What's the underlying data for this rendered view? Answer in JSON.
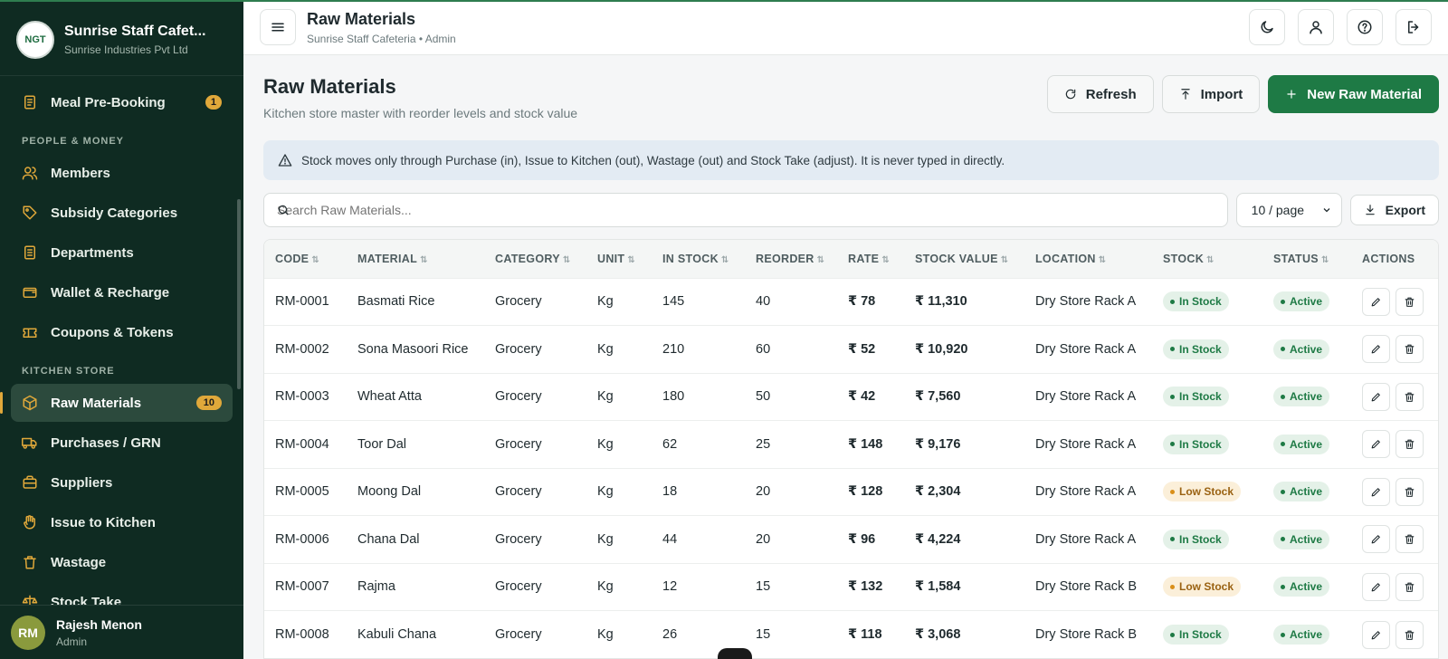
{
  "brand": {
    "name": "Sunrise Staff Cafet...",
    "sub": "Sunrise Industries Pvt Ltd",
    "logo_text": "NGT"
  },
  "sidebar": {
    "top_item": {
      "label": "Meal Pre-Booking",
      "badge": "1"
    },
    "section1": "PEOPLE & MONEY",
    "people": [
      {
        "label": "Members"
      },
      {
        "label": "Subsidy Categories"
      },
      {
        "label": "Departments"
      },
      {
        "label": "Wallet & Recharge"
      },
      {
        "label": "Coupons & Tokens"
      }
    ],
    "section2": "KITCHEN STORE",
    "kitchen": [
      {
        "label": "Raw Materials",
        "badge": "10"
      },
      {
        "label": "Purchases / GRN"
      },
      {
        "label": "Suppliers"
      },
      {
        "label": "Issue to Kitchen"
      },
      {
        "label": "Wastage"
      },
      {
        "label": "Stock Take"
      }
    ]
  },
  "user": {
    "initials": "RM",
    "name": "Rajesh Menon",
    "role": "Admin"
  },
  "topbar": {
    "title": "Raw Materials",
    "subtitle": "Sunrise Staff Cafeteria • Admin"
  },
  "page": {
    "title": "Raw Materials",
    "subtitle": "Kitchen store master with reorder levels and stock value",
    "refresh": "Refresh",
    "import": "Import",
    "new": "New Raw Material",
    "notice": "Stock moves only through Purchase (in), Issue to Kitchen (out), Wastage (out) and Stock Take (adjust). It is never typed in directly.",
    "search_placeholder": "Search Raw Materials...",
    "page_size": "10 / page",
    "export": "Export"
  },
  "table": {
    "columns": [
      "CODE",
      "MATERIAL",
      "CATEGORY",
      "UNIT",
      "IN STOCK",
      "REORDER",
      "RATE",
      "STOCK VALUE",
      "LOCATION",
      "STOCK",
      "STATUS",
      "ACTIONS"
    ],
    "rows": [
      {
        "code": "RM-0001",
        "material": "Basmati Rice",
        "category": "Grocery",
        "unit": "Kg",
        "in_stock": "145",
        "reorder": "40",
        "rate": "₹ 78",
        "value": "₹ 11,310",
        "location": "Dry Store Rack A",
        "stock": "In Stock",
        "status": "Active"
      },
      {
        "code": "RM-0002",
        "material": "Sona Masoori Rice",
        "category": "Grocery",
        "unit": "Kg",
        "in_stock": "210",
        "reorder": "60",
        "rate": "₹ 52",
        "value": "₹ 10,920",
        "location": "Dry Store Rack A",
        "stock": "In Stock",
        "status": "Active"
      },
      {
        "code": "RM-0003",
        "material": "Wheat Atta",
        "category": "Grocery",
        "unit": "Kg",
        "in_stock": "180",
        "reorder": "50",
        "rate": "₹ 42",
        "value": "₹ 7,560",
        "location": "Dry Store Rack A",
        "stock": "In Stock",
        "status": "Active"
      },
      {
        "code": "RM-0004",
        "material": "Toor Dal",
        "category": "Grocery",
        "unit": "Kg",
        "in_stock": "62",
        "reorder": "25",
        "rate": "₹ 148",
        "value": "₹ 9,176",
        "location": "Dry Store Rack A",
        "stock": "In Stock",
        "status": "Active"
      },
      {
        "code": "RM-0005",
        "material": "Moong Dal",
        "category": "Grocery",
        "unit": "Kg",
        "in_stock": "18",
        "reorder": "20",
        "rate": "₹ 128",
        "value": "₹ 2,304",
        "location": "Dry Store Rack A",
        "stock": "Low Stock",
        "status": "Active"
      },
      {
        "code": "RM-0006",
        "material": "Chana Dal",
        "category": "Grocery",
        "unit": "Kg",
        "in_stock": "44",
        "reorder": "20",
        "rate": "₹ 96",
        "value": "₹ 4,224",
        "location": "Dry Store Rack A",
        "stock": "In Stock",
        "status": "Active"
      },
      {
        "code": "RM-0007",
        "material": "Rajma",
        "category": "Grocery",
        "unit": "Kg",
        "in_stock": "12",
        "reorder": "15",
        "rate": "₹ 132",
        "value": "₹ 1,584",
        "location": "Dry Store Rack B",
        "stock": "Low Stock",
        "status": "Active"
      },
      {
        "code": "RM-0008",
        "material": "Kabuli Chana",
        "category": "Grocery",
        "unit": "Kg",
        "in_stock": "26",
        "reorder": "15",
        "rate": "₹ 118",
        "value": "₹ 3,068",
        "location": "Dry Store Rack B",
        "stock": "In Stock",
        "status": "Active"
      }
    ]
  },
  "colors": {
    "sidebar_bg": "#0f2b22",
    "accent": "#e0a83a",
    "primary": "#1e7a45",
    "low_stock": "#d98f1a"
  }
}
